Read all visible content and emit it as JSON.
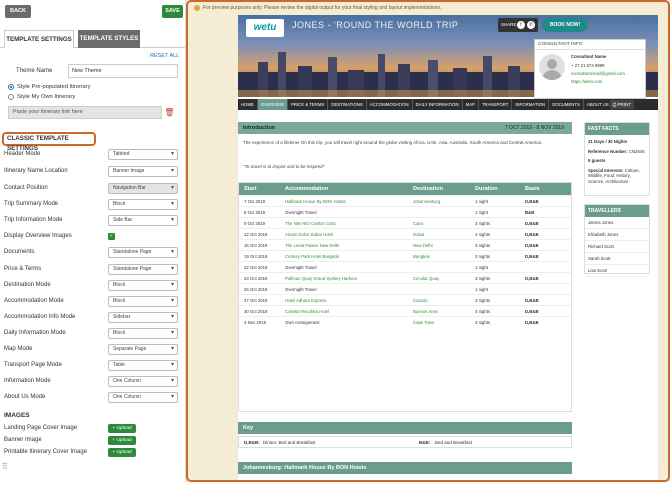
{
  "topbar": {
    "back": "BACK",
    "save": "SAVE"
  },
  "tabs": {
    "settings": "TEMPLATE SETTINGS",
    "styles": "TEMPLATE STYLES"
  },
  "reset_all": "RESET ALL",
  "theme": {
    "label": "Theme Name",
    "value": "New Theme"
  },
  "radios": [
    {
      "label": "Style Pre-populated Itinerary",
      "checked": true
    },
    {
      "label": "Style My Own Itinerary",
      "checked": false
    }
  ],
  "paste_placeholder": "Paste your itinerary link here",
  "section_title": "CLASSIC TEMPLATE SETTINGS",
  "settings": [
    {
      "label": "Header Mode",
      "value": "Tabbed"
    },
    {
      "label": "Itinerary Name Location",
      "value": "Banner Image"
    },
    {
      "label": "Contact Position",
      "value": "Navigation Bar"
    },
    {
      "label": "Trip Summary Mode",
      "value": "Block"
    },
    {
      "label": "Trip Information Mode",
      "value": "Side Bar"
    },
    {
      "label": "Display Overview Images",
      "value": ""
    },
    {
      "label": "Documents",
      "value": "Standalone Page"
    },
    {
      "label": "Price & Terms",
      "value": "Standalone Page"
    },
    {
      "label": "Destination Mode",
      "value": "Block"
    },
    {
      "label": "Accommodation Mode",
      "value": "Block"
    },
    {
      "label": "Accommodation Info Mode",
      "value": "Sidebar"
    },
    {
      "label": "Daily Information Mode",
      "value": "Block"
    },
    {
      "label": "Map Mode",
      "value": "Separate Page"
    },
    {
      "label": "Transport Page Mode",
      "value": "Table"
    },
    {
      "label": "Information Mode",
      "value": "One Column"
    },
    {
      "label": "About Us Mode",
      "value": "One Column"
    }
  ],
  "images": {
    "title": "IMAGES",
    "items": [
      {
        "label": "Landing Page Cover Image",
        "button": "+ Upload"
      },
      {
        "label": "Banner Image",
        "button": "+ Upload"
      },
      {
        "label": "Printable Itinerary Cover Image",
        "button": "+ Upload"
      }
    ]
  },
  "preview": {
    "notice": "For preview purposes only. Please review the digital output for your final styling and layout implementations.",
    "logo": "wetu",
    "hero_title": "JONES - 'ROUND THE WORLD TRIP",
    "share": "SHARE",
    "book_now": "BOOK NOW!",
    "consultant": {
      "title": "CONSULTANT INFO",
      "name": "Consultant Name",
      "phone": "+ 27 21 674 9999",
      "email": "consultantemail@gmail.com",
      "web": "https://wetu.com"
    },
    "nav": [
      "HOME",
      "OVERVIEW",
      "PRICE & TERMS",
      "DESTINATIONS",
      "ACCOMMODATION",
      "DAILY INFORMATION",
      "MAP",
      "TRANSPORT",
      "INFORMATION",
      "DOCUMENTS",
      "ABOUT US"
    ],
    "print": "PRINT",
    "intro": {
      "title": "Introduction",
      "dates": "7 OCT 2019 - 8 NOV 2019",
      "text": "The experience of a lifetime! On this trip, you will travel right around the globe visiting Africa, UAE, Asia, Australia, South America and Central America.",
      "quote": "\"To travel is to inspire and to be inspired\""
    },
    "table": {
      "headers": [
        "Start",
        "Accommodation",
        "Destination",
        "Duration",
        "Basis"
      ],
      "rows": [
        [
          "7 Oct 2019",
          "Hallmark House By BON Hotels",
          "Johannesburg",
          "1 night",
          "D,B&B"
        ],
        [
          "8 Oct 2019",
          "Overnight Travel",
          "",
          "1 night",
          "B&B"
        ],
        [
          "9 Oct 2019",
          "The Nile Ritz-Carlton Cairo",
          "Cairo",
          "3 nights",
          "D,B&B"
        ],
        [
          "12 Oct 2019",
          "Amani Dolce Dubai Hotel",
          "Dubai",
          "4 nights",
          "D,B&B"
        ],
        [
          "16 Oct 2019",
          "The Leela Palace New Delhi",
          "New Delhi",
          "3 nights",
          "D,B&B"
        ],
        [
          "19 Oct 2019",
          "Century Park Hotel Bangkok",
          "Bangkok",
          "3 nights",
          "D,B&B"
        ],
        [
          "22 Oct 2019",
          "Overnight Travel",
          "",
          "1 night",
          ""
        ],
        [
          "23 Oct 2019",
          "Pullman Quay Grand Sydney Harbour",
          "Circular Quay",
          "3 nights",
          "D,B&B"
        ],
        [
          "26 Oct 2019",
          "Overnight Travel",
          "",
          "1 night",
          ""
        ],
        [
          "27 Oct 2019",
          "Hotel Adhara Express",
          "Cancún",
          "3 nights",
          "D,B&B"
        ],
        [
          "30 Oct 2019",
          "Cosetta Recoleta Hotel",
          "Buenos Aires",
          "4 nights",
          "D,B&B"
        ],
        [
          "3 Nov 2019",
          "Own Arrangement",
          "Cape Town",
          "3 nights",
          "D,B&B"
        ]
      ]
    },
    "key": {
      "title": "Key",
      "items": [
        {
          "code": "D,B&B:",
          "desc": "Dinner, Bed and Breakfast"
        },
        {
          "code": "B&B:",
          "desc": "Bed and Breakfast"
        }
      ]
    },
    "next_section": "Johannesburg: Hallmark House By BON Hotels",
    "fast_facts": {
      "title": "FAST FACTS",
      "duration": "31 Days / 30 Nights",
      "ref_label": "Reference Number:",
      "ref_value": "CN2646",
      "guests": "5 guests",
      "interests_label": "Special Interests:",
      "interests_value": "Culture, Wildlife, Food, History, Science, Architecture"
    },
    "travellers": {
      "title": "TRAVELLERS",
      "names": [
        "James Jones",
        "Elizabeth Jones",
        "Richard Scott",
        "Sarah Scott",
        "Lisa Scott"
      ]
    }
  }
}
